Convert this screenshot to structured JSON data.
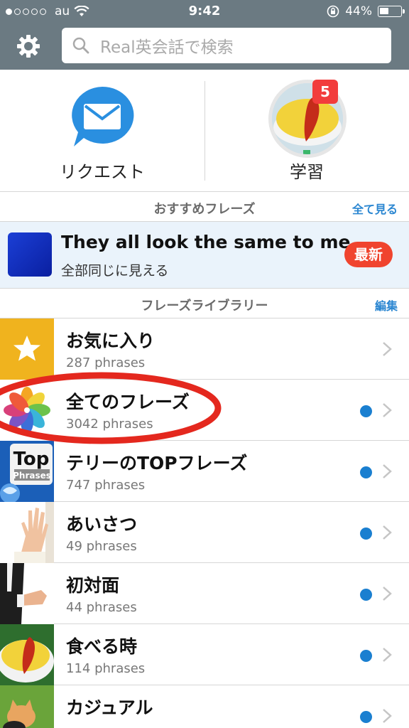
{
  "status_bar": {
    "carrier": "au",
    "time": "9:42",
    "battery": "44%",
    "battery_level": 0.44
  },
  "nav": {
    "settings_icon": "gear-icon",
    "search_icon": "search-icon",
    "search_placeholder": "Real英会話で検索"
  },
  "actions": {
    "request_label": "リクエスト",
    "request_icon": "mail-icon",
    "study_label": "学習",
    "study_badge": "5"
  },
  "recommended": {
    "title": "おすすめフレーズ",
    "see_all": "全て見る",
    "phrase_en": "They all look the same to me.",
    "phrase_ja": "全部同じに見える",
    "new_badge": "最新"
  },
  "library": {
    "title": "フレーズライブラリー",
    "edit": "編集",
    "items": [
      {
        "title": "お気に入り",
        "count": "287 phrases",
        "icon": "star-icon",
        "unread": false
      },
      {
        "title": "全てのフレーズ",
        "count": "3042 phrases",
        "icon": "color-petal-icon",
        "unread": true
      },
      {
        "title": "テリーのTOPフレーズ",
        "count": "747 phrases",
        "icon": "top-phrases-icon",
        "unread": true
      },
      {
        "title": "あいさつ",
        "count": "49 phrases",
        "icon": "waving-hand-photo",
        "unread": true
      },
      {
        "title": "初対面",
        "count": "44 phrases",
        "icon": "handshake-photo",
        "unread": true
      },
      {
        "title": "食べる時",
        "count": "114 phrases",
        "icon": "omelette-photo",
        "unread": true
      },
      {
        "title": "カジュアル",
        "count": "",
        "icon": "cat-photo",
        "unread": true
      }
    ]
  },
  "thumb_text": {
    "top_big": "Top",
    "top_small": "Phrases"
  },
  "colors": {
    "bar": "#6b7a82",
    "accent": "#2a86d1",
    "badge_red": "#f23c3c",
    "unread_dot": "#1a7fd0",
    "highlight_red": "#e4281e"
  }
}
